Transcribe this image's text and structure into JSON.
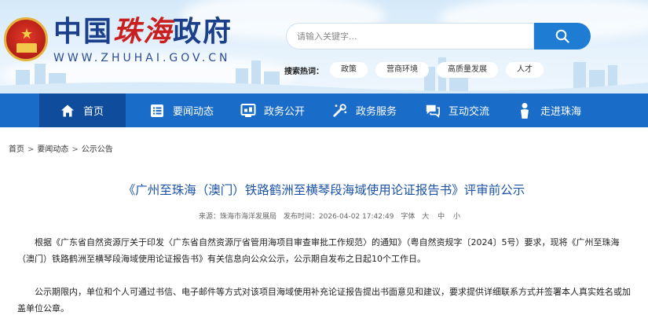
{
  "header": {
    "title_prefix": "中国",
    "title_accent": "珠海",
    "title_suffix": "政府",
    "domain": "WWW.ZHUHAI.GOV.CN",
    "search_placeholder": "请输入关键字...",
    "hot_label": "搜索热词：",
    "hot_words": [
      "政策",
      "营商环境",
      "高质量发展",
      "人才"
    ]
  },
  "nav": {
    "items": [
      {
        "label": "首页",
        "icon": "home-icon"
      },
      {
        "label": "要闻动态",
        "icon": "news-list-icon"
      },
      {
        "label": "政务公开",
        "icon": "open-gov-icon"
      },
      {
        "label": "政务服务",
        "icon": "service-icon"
      },
      {
        "label": "互动交流",
        "icon": "chat-icon"
      },
      {
        "label": "走进珠海",
        "icon": "person-icon"
      }
    ],
    "active_index": 0
  },
  "breadcrumb": [
    "首页",
    "要闻动态",
    "公示公告"
  ],
  "breadcrumb_sep": ">",
  "article": {
    "title": "《广州至珠海（澳门）铁路鹤洲至横琴段海域使用论证报告书》评审前公示",
    "source_label": "来源：",
    "source": "珠海市海洋发展局",
    "published": "发布时间：2026-04-02 17:42:49",
    "font_label": "字体",
    "font_sizes": [
      "大",
      "中",
      "小"
    ],
    "paragraphs": [
      "根据《广东省自然资源厅关于印发〈广东省自然资源厅省管用海项目审查审批工作规范〉的通知》（粤自然资规字〔2024〕5号）要求，现将《广州至珠海（澳门）铁路鹤洲至横琴段海域使用论证报告书》有关信息向公众公示，公示期自发布之日起10个工作日。",
      "公示期限内，单位和个人可通过书信、电子邮件等方式对该项目海域使用补充论证报告提出书面意见和建议，要求提供详细联系方式并签署本人真实姓名或加盖单位公章。"
    ]
  },
  "colors": {
    "nav_bg": "#1a6cc9",
    "nav_active": "#0f4c9c",
    "title_blue": "#1c53a7",
    "brand_red": "#c9201f",
    "brand_blue": "#1b3f8b",
    "search_btn": "#1e7dd3"
  }
}
